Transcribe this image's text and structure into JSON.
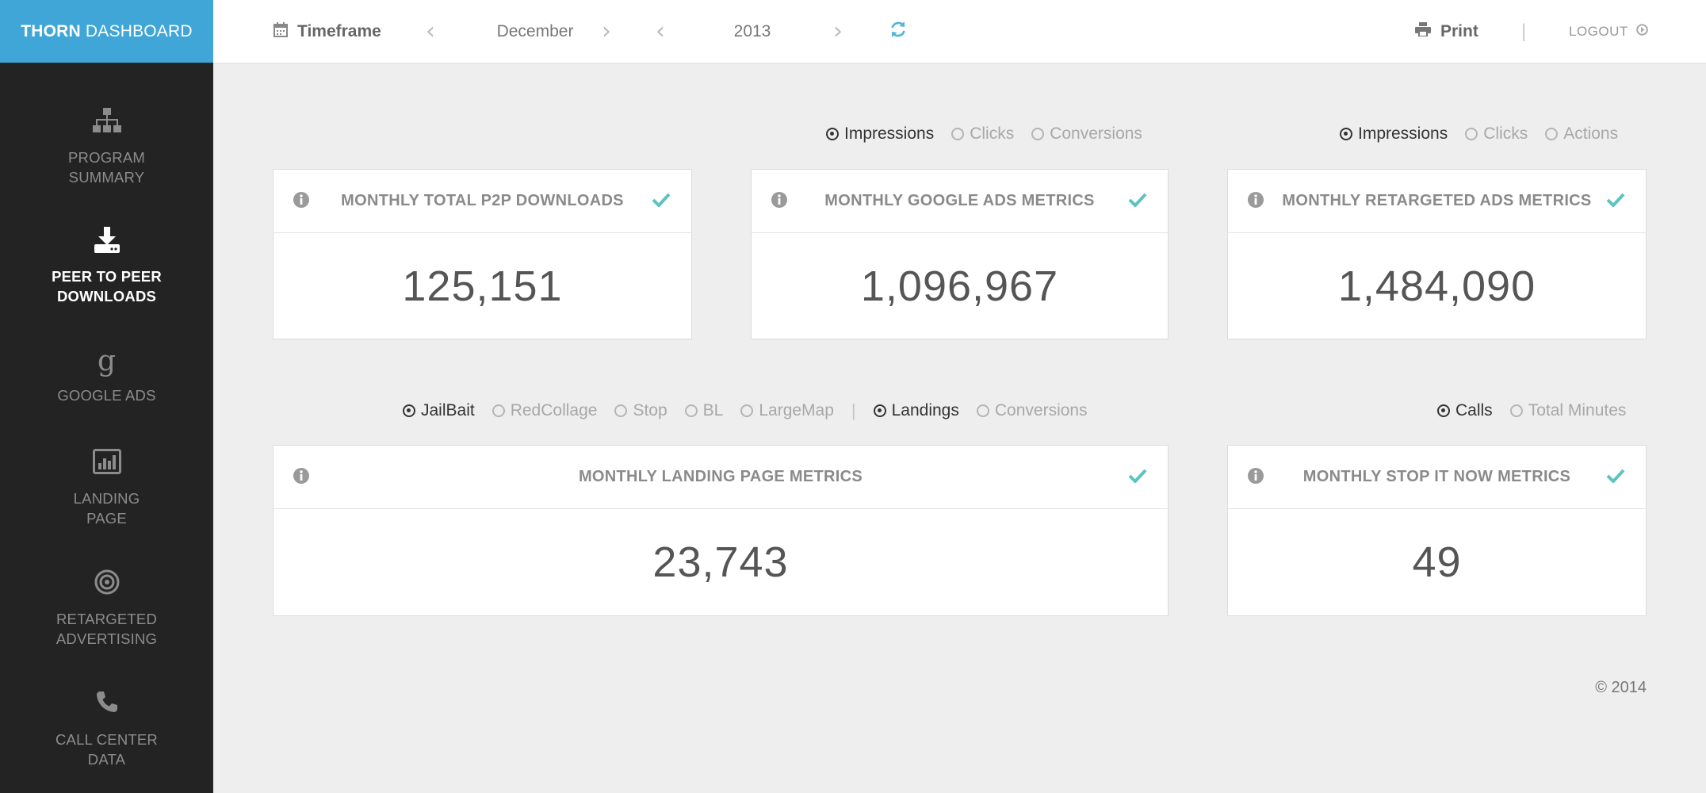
{
  "brand": {
    "bold": "THORN",
    "rest": "DASHBOARD",
    "color": "#40a6d8"
  },
  "sidebar": {
    "items": [
      {
        "label": "PROGRAM\nSUMMARY",
        "icon": "sitemap-icon",
        "active": false
      },
      {
        "label": "PEER TO PEER\nDOWNLOADS",
        "icon": "download-icon",
        "active": true
      },
      {
        "label": "GOOGLE ADS",
        "icon": "google-g-icon",
        "active": false
      },
      {
        "label": "LANDING\nPAGE",
        "icon": "bar-chart-icon",
        "active": false
      },
      {
        "label": "RETARGETED\nADVERTISING",
        "icon": "target-icon",
        "active": false
      },
      {
        "label": "CALL CENTER\nDATA",
        "icon": "phone-icon",
        "active": false
      }
    ]
  },
  "topbar": {
    "timeframe_label": "Timeframe",
    "month": "December",
    "year": "2013",
    "print_label": "Print",
    "separator": "|",
    "logout_label": "LOGOUT"
  },
  "toggles": {
    "google": {
      "options": [
        "Impressions",
        "Clicks",
        "Conversions"
      ],
      "selected": "Impressions"
    },
    "retargeted": {
      "options": [
        "Impressions",
        "Clicks",
        "Actions"
      ],
      "selected": "Impressions"
    },
    "landing_sites": {
      "options": [
        "JailBait",
        "RedCollage",
        "Stop",
        "BL",
        "LargeMap"
      ],
      "selected": "JailBait"
    },
    "landing_divider": "|",
    "landing_type": {
      "options": [
        "Landings",
        "Conversions"
      ],
      "selected": "Landings"
    },
    "calls": {
      "options": [
        "Calls",
        "Total Minutes"
      ],
      "selected": "Calls"
    }
  },
  "cards": {
    "p2p": {
      "title": "MONTHLY TOTAL P2P DOWNLOADS",
      "value": "125,151"
    },
    "google": {
      "title": "MONTHLY GOOGLE ADS METRICS",
      "value": "1,096,967"
    },
    "retargeted": {
      "title": "MONTHLY RETARGETED ADS METRICS",
      "value": "1,484,090"
    },
    "landing": {
      "title": "MONTHLY LANDING PAGE METRICS",
      "value": "23,743"
    },
    "stop": {
      "title": "MONTHLY STOP IT NOW METRICS",
      "value": "49"
    }
  },
  "footer": {
    "copyright": "© 2014"
  },
  "colors": {
    "accent": "#40a6d8",
    "check": "#5cc4c0",
    "sidebar": "#232323"
  }
}
